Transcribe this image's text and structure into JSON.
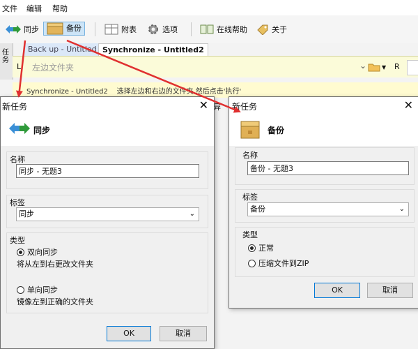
{
  "menu": {
    "file": "文件",
    "edit": "编辑",
    "help": "帮助"
  },
  "toolbar": {
    "sync": "同步",
    "backup": "备份",
    "attachment": "附表",
    "options": "选项",
    "online_help": "在线帮助",
    "about": "关于"
  },
  "tabs": [
    "Back up - Untitled",
    "Synchronize - Untitled2"
  ],
  "left_strip_label": "任务",
  "path_row": {
    "left_label": "L",
    "placeholder": "左边文件夹",
    "right_label": "R"
  },
  "info_bar": {
    "text": "Synchronize - Untitled2    选择左边和右边的文件夹,然后点击'执行'"
  },
  "behind_fragment": "异",
  "dialog_sync": {
    "title": "新任务",
    "close": "✕",
    "heading": "同步",
    "name_label": "名称",
    "name_value": "同步 - 无题3",
    "tag_label": "标签",
    "tag_value": "同步",
    "type_label": "类型",
    "options": [
      {
        "label": "双向同步",
        "desc": "将从左到右更改文件夹",
        "checked": true
      },
      {
        "label": "单向同步",
        "desc": "镜像左到正确的文件夹",
        "checked": false
      }
    ],
    "ok": "OK",
    "cancel": "取消"
  },
  "dialog_backup": {
    "title": "新任务",
    "close": "✕",
    "heading": "备份",
    "name_label": "名称",
    "name_value": "备份 - 无题3",
    "tag_label": "标签",
    "tag_value": "备份",
    "type_label": "类型",
    "options": [
      {
        "label": "正常",
        "checked": true
      },
      {
        "label": "压缩文件到ZIP",
        "checked": false
      }
    ],
    "ok": "OK",
    "cancel": "取消"
  },
  "colors": {
    "accent": "#0078d7",
    "annotation_arrow": "#e03030",
    "sync_icon": "#2f8a3a"
  }
}
